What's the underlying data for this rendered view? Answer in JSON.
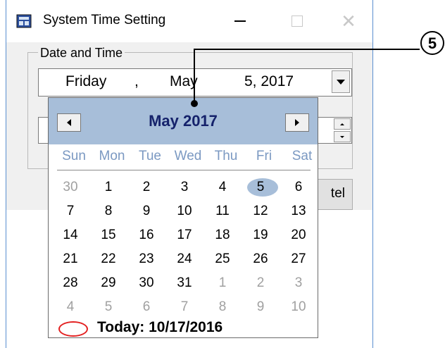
{
  "window": {
    "title": "System Time Setting",
    "buttons": {
      "minimize": "minimize-icon",
      "maximize": "maximize-icon",
      "close": "close-icon"
    }
  },
  "group": {
    "legend": "Date and Time"
  },
  "date_picker": {
    "weekday": "Friday",
    "sep": ",",
    "month": "May",
    "daymonth_year": "5, 2017"
  },
  "cancel_button": {
    "label": "Cancel",
    "visible_label": "tel"
  },
  "calendar": {
    "title": "May 2017",
    "days_of_week": [
      "Sun",
      "Mon",
      "Tue",
      "Wed",
      "Thu",
      "Fri",
      "Sat"
    ],
    "weeks": [
      [
        "30",
        "1",
        "2",
        "3",
        "4",
        "5",
        "6"
      ],
      [
        "7",
        "8",
        "9",
        "10",
        "11",
        "12",
        "13"
      ],
      [
        "14",
        "15",
        "16",
        "17",
        "18",
        "19",
        "20"
      ],
      [
        "21",
        "22",
        "23",
        "24",
        "25",
        "26",
        "27"
      ],
      [
        "28",
        "29",
        "30",
        "31",
        "1",
        "2",
        "3"
      ],
      [
        "4",
        "5",
        "6",
        "7",
        "8",
        "9",
        "10"
      ]
    ],
    "other_month_cells": [
      [
        0,
        0
      ],
      [
        4,
        4
      ],
      [
        4,
        5
      ],
      [
        4,
        6
      ],
      [
        5,
        0
      ],
      [
        5,
        1
      ],
      [
        5,
        2
      ],
      [
        5,
        3
      ],
      [
        5,
        4
      ],
      [
        5,
        5
      ],
      [
        5,
        6
      ]
    ],
    "selected_day": "5",
    "today_label": "Today: 10/17/2016"
  },
  "callout": {
    "label": "⑤"
  },
  "colors": {
    "header": "#a7bed9",
    "title": "#15226b",
    "dow": "#7b99c2",
    "today_mark": "#e32020"
  }
}
